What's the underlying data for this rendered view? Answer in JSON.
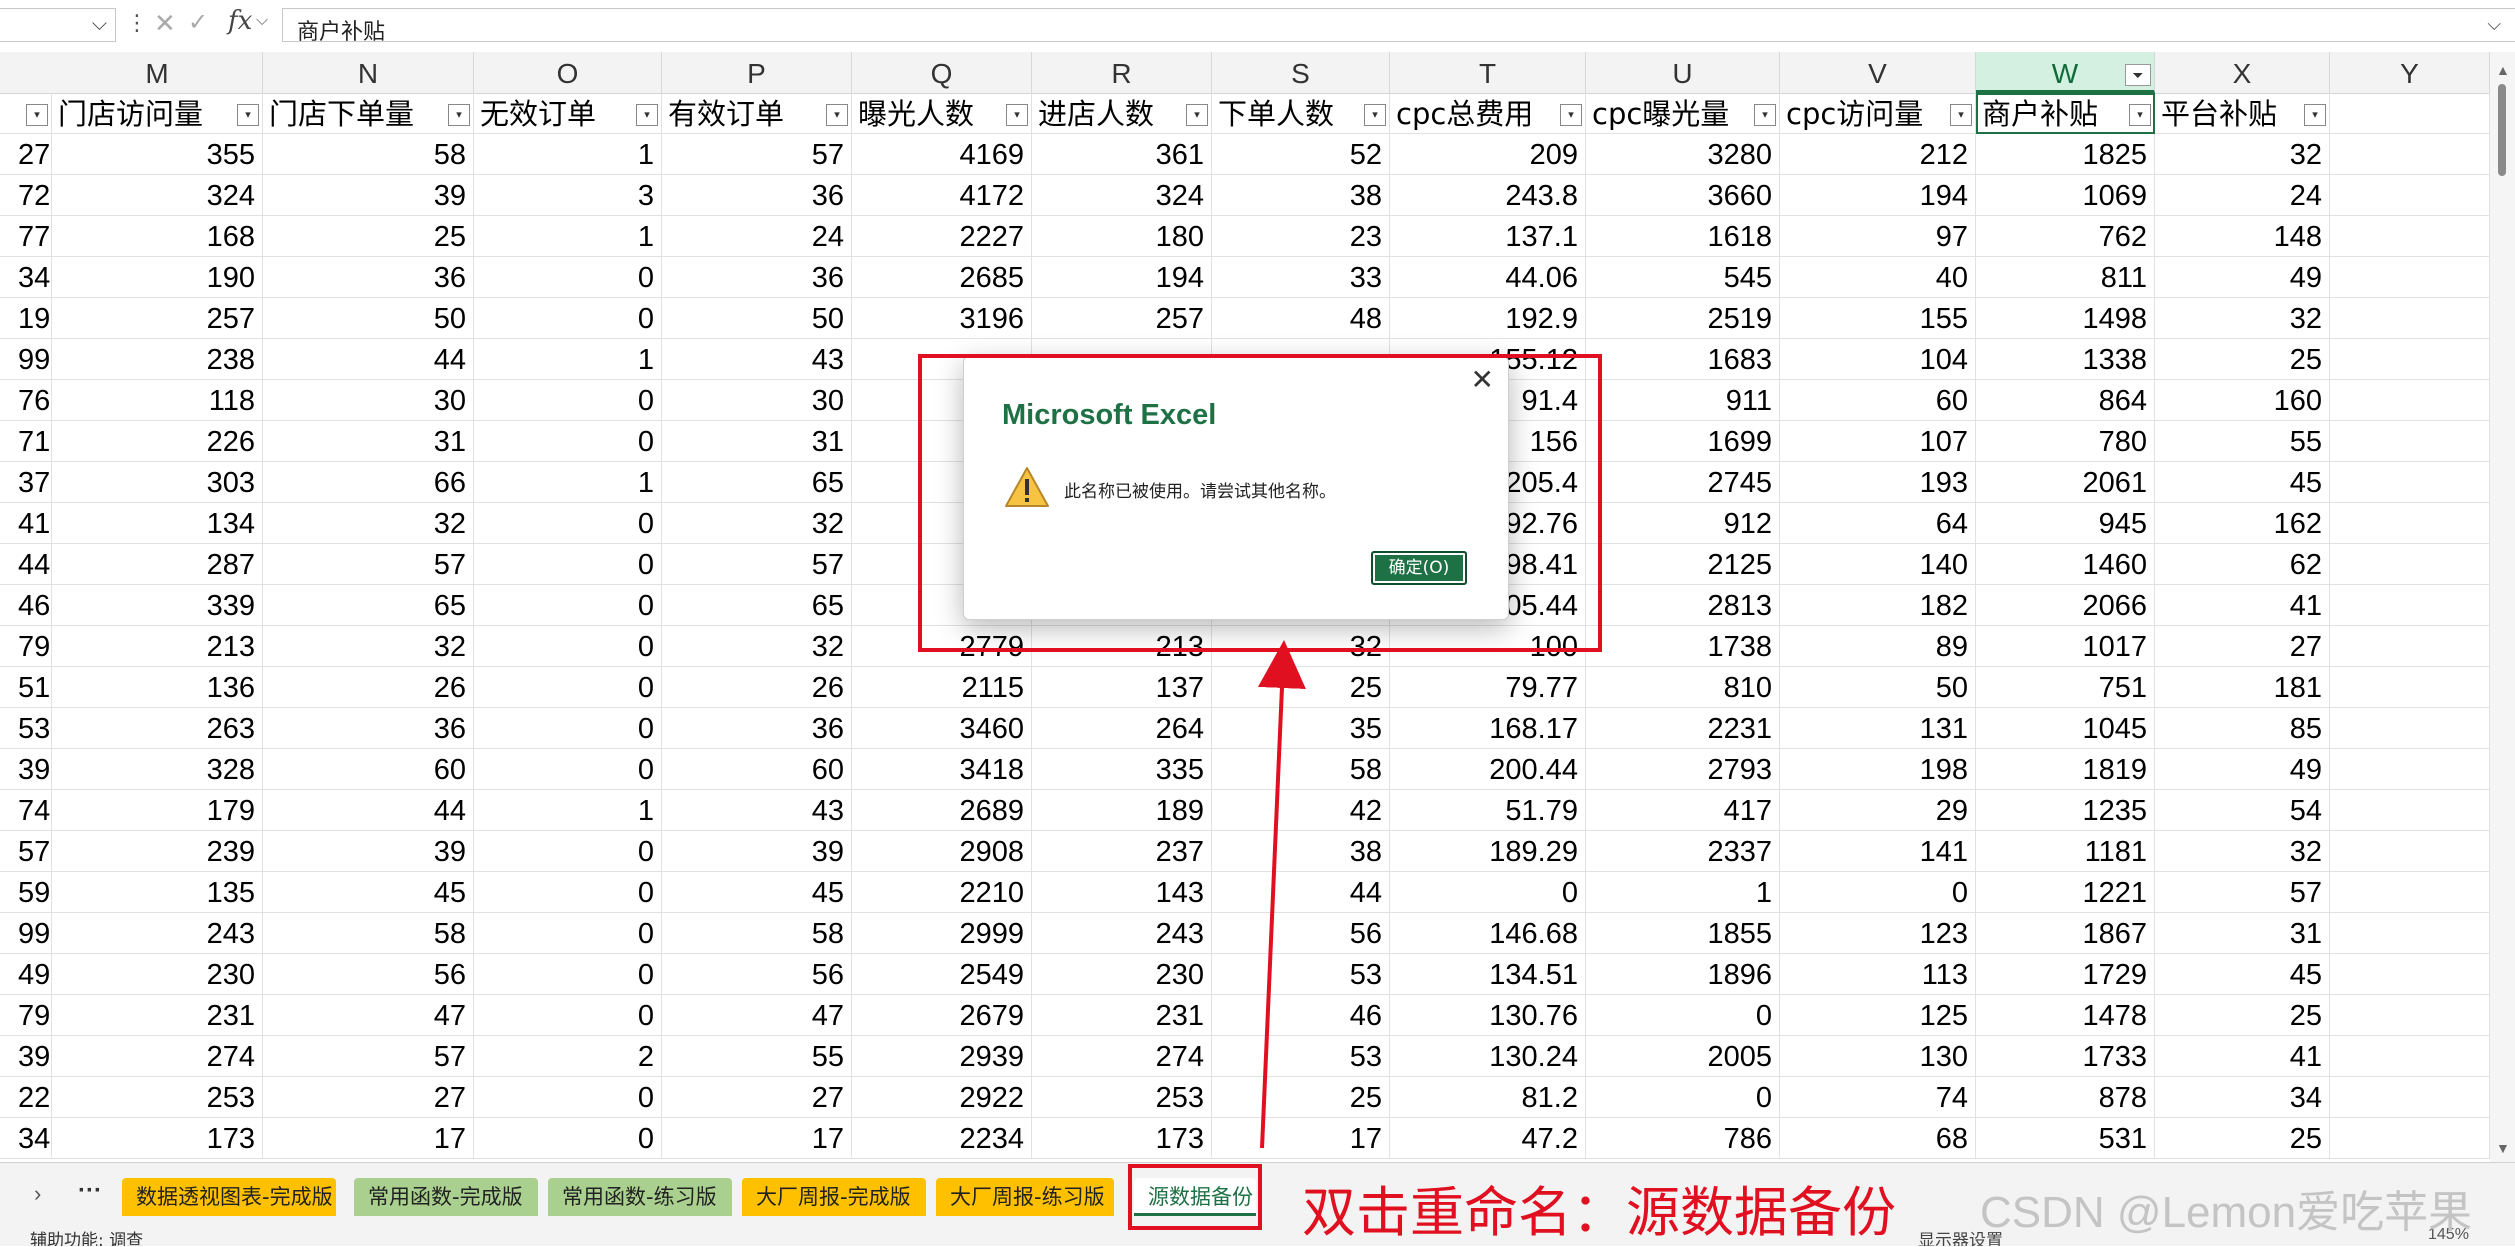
{
  "formula_bar": {
    "name_box": "",
    "cancel_icon": "close-icon",
    "enter_icon": "check-icon",
    "fx_label": "fx",
    "content": "商户补贴"
  },
  "sheet": {
    "columns": [
      "M",
      "N",
      "O",
      "P",
      "Q",
      "R",
      "S",
      "T",
      "U",
      "V",
      "W",
      "X",
      "Y"
    ],
    "selected_column": "W",
    "filtered_column": "W",
    "headers": [
      "门店访问量",
      "门店下单量",
      "无效订单",
      "有效订单",
      "曝光人数",
      "进店人数",
      "下单人数",
      "cpc总费用",
      "cpc曝光量",
      "cpc访问量",
      "商户补贴",
      "平台补贴"
    ],
    "stub_header": "",
    "rows": [
      {
        "stub": "27",
        "values": [
          "355",
          "58",
          "1",
          "57",
          "4169",
          "361",
          "52",
          "209",
          "3280",
          "212",
          "1825",
          "32"
        ]
      },
      {
        "stub": "72",
        "values": [
          "324",
          "39",
          "3",
          "36",
          "4172",
          "324",
          "38",
          "243.8",
          "3660",
          "194",
          "1069",
          "24"
        ]
      },
      {
        "stub": "77",
        "values": [
          "168",
          "25",
          "1",
          "24",
          "2227",
          "180",
          "23",
          "137.1",
          "1618",
          "97",
          "762",
          "148"
        ]
      },
      {
        "stub": "34",
        "values": [
          "190",
          "36",
          "0",
          "36",
          "2685",
          "194",
          "33",
          "44.06",
          "545",
          "40",
          "811",
          "49"
        ]
      },
      {
        "stub": "19",
        "values": [
          "257",
          "50",
          "0",
          "50",
          "3196",
          "257",
          "48",
          "192.9",
          "2519",
          "155",
          "1498",
          "32"
        ]
      },
      {
        "stub": "99",
        "values": [
          "238",
          "44",
          "1",
          "43",
          "",
          "",
          "",
          "155.12",
          "1683",
          "104",
          "1338",
          "25"
        ]
      },
      {
        "stub": "76",
        "values": [
          "118",
          "30",
          "0",
          "30",
          "",
          "",
          "",
          "91.4",
          "911",
          "60",
          "864",
          "160"
        ]
      },
      {
        "stub": "71",
        "values": [
          "226",
          "31",
          "0",
          "31",
          "",
          "",
          "",
          "156",
          "1699",
          "107",
          "780",
          "55"
        ]
      },
      {
        "stub": "37",
        "values": [
          "303",
          "66",
          "1",
          "65",
          "",
          "",
          "",
          "205.4",
          "2745",
          "193",
          "2061",
          "45"
        ]
      },
      {
        "stub": "41",
        "values": [
          "134",
          "32",
          "0",
          "32",
          "",
          "",
          "",
          "92.76",
          "912",
          "64",
          "945",
          "162"
        ]
      },
      {
        "stub": "44",
        "values": [
          "287",
          "57",
          "0",
          "57",
          "",
          "",
          "",
          "98.41",
          "2125",
          "140",
          "1460",
          "62"
        ]
      },
      {
        "stub": "46",
        "values": [
          "339",
          "65",
          "0",
          "65",
          "",
          "",
          "",
          "05.44",
          "2813",
          "182",
          "2066",
          "41"
        ]
      },
      {
        "stub": "79",
        "values": [
          "213",
          "32",
          "0",
          "32",
          "2779",
          "213",
          "32",
          "100",
          "1738",
          "89",
          "1017",
          "27"
        ]
      },
      {
        "stub": "51",
        "values": [
          "136",
          "26",
          "0",
          "26",
          "2115",
          "137",
          "25",
          "79.77",
          "810",
          "50",
          "751",
          "181"
        ]
      },
      {
        "stub": "53",
        "values": [
          "263",
          "36",
          "0",
          "36",
          "3460",
          "264",
          "35",
          "168.17",
          "2231",
          "131",
          "1045",
          "85"
        ]
      },
      {
        "stub": "39",
        "values": [
          "328",
          "60",
          "0",
          "60",
          "3418",
          "335",
          "58",
          "200.44",
          "2793",
          "198",
          "1819",
          "49"
        ]
      },
      {
        "stub": "74",
        "values": [
          "179",
          "44",
          "1",
          "43",
          "2689",
          "189",
          "42",
          "51.79",
          "417",
          "29",
          "1235",
          "54"
        ]
      },
      {
        "stub": "57",
        "values": [
          "239",
          "39",
          "0",
          "39",
          "2908",
          "237",
          "38",
          "189.29",
          "2337",
          "141",
          "1181",
          "32"
        ]
      },
      {
        "stub": "59",
        "values": [
          "135",
          "45",
          "0",
          "45",
          "2210",
          "143",
          "44",
          "0",
          "1",
          "0",
          "1221",
          "57"
        ]
      },
      {
        "stub": "99",
        "values": [
          "243",
          "58",
          "0",
          "58",
          "2999",
          "243",
          "56",
          "146.68",
          "1855",
          "123",
          "1867",
          "31"
        ]
      },
      {
        "stub": "49",
        "values": [
          "230",
          "56",
          "0",
          "56",
          "2549",
          "230",
          "53",
          "134.51",
          "1896",
          "113",
          "1729",
          "45"
        ]
      },
      {
        "stub": "79",
        "values": [
          "231",
          "47",
          "0",
          "47",
          "2679",
          "231",
          "46",
          "130.76",
          "0",
          "125",
          "1478",
          "25"
        ]
      },
      {
        "stub": "39",
        "values": [
          "274",
          "57",
          "2",
          "55",
          "2939",
          "274",
          "53",
          "130.24",
          "2005",
          "130",
          "1733",
          "41"
        ]
      },
      {
        "stub": "22",
        "values": [
          "253",
          "27",
          "0",
          "27",
          "2922",
          "253",
          "25",
          "81.2",
          "0",
          "74",
          "878",
          "34"
        ]
      },
      {
        "stub": "34",
        "values": [
          "173",
          "17",
          "0",
          "17",
          "2234",
          "173",
          "17",
          "47.2",
          "786",
          "68",
          "531",
          "25"
        ]
      }
    ]
  },
  "dialog": {
    "title": "Microsoft Excel",
    "message": "此名称已被使用。请尝试其他名称。",
    "ok_button": "确定(O)",
    "close_icon": "close-icon",
    "warning_icon": "warning-icon"
  },
  "tabs": {
    "nav_icon": "chevron-right-icon",
    "more": "···",
    "items": [
      "数据透视图表-完成版",
      "常用函数-完成版",
      "常用函数-练习版",
      "大厂周报-完成版",
      "大厂周报-练习版",
      "源数据备份"
    ],
    "active_index": 5,
    "colors": [
      "#ffc000",
      "#a9d08e",
      "#a9d08e",
      "#ffc000",
      "#ffc000",
      "#ffffff"
    ]
  },
  "annotation": {
    "caption": "双击重命名：源数据备份",
    "color": "#e01020"
  },
  "watermark": "CSDN @Lemon爱吃苹果",
  "status_bar": {
    "accessibility": "辅助功能: 调查",
    "display_settings": "显示器设置",
    "zoom": "145%"
  }
}
